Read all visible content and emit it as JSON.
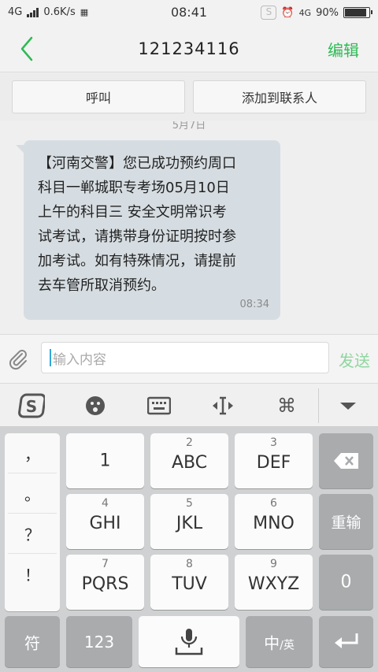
{
  "status_bar": {
    "network_left": "4G",
    "speed": "0.6K/s",
    "time": "08:41",
    "network_right": "4G",
    "battery": "90%",
    "battery_level": 0.9
  },
  "header": {
    "title": "121234116",
    "edit_label": "编辑",
    "accent_color": "#2fba55"
  },
  "actions": {
    "call_label": "呼叫",
    "add_contact_label": "添加到联系人"
  },
  "conversation": {
    "date": "5月7日",
    "messages": [
      {
        "lines": [
          "【河南交警】您已成功预约周口",
          "科目一郸城职专考场05月10日",
          "上午的科目三 安全文明常识考",
          "试考试，请携带身份证明按时参",
          "加考试。如有特殊情况，请提前",
          "去车管所取消预约。"
        ],
        "time": "08:34"
      }
    ]
  },
  "composer": {
    "placeholder": "输入内容",
    "send_label": "发送"
  },
  "ime_toolbar": {
    "icons": [
      "sogou-logo-icon",
      "emoji-icon",
      "keyboard-icon",
      "cursor-move-icon",
      "command-icon",
      "collapse-icon"
    ]
  },
  "keyboard": {
    "punctuation": [
      "，",
      "。",
      "？",
      "！"
    ],
    "keys": [
      {
        "num": "",
        "label": "1"
      },
      {
        "num": "2",
        "label": "ABC"
      },
      {
        "num": "3",
        "label": "DEF"
      },
      {
        "num": "4",
        "label": "GHI"
      },
      {
        "num": "5",
        "label": "JKL"
      },
      {
        "num": "6",
        "label": "MNO"
      },
      {
        "num": "7",
        "label": "PQRS"
      },
      {
        "num": "8",
        "label": "TUV"
      },
      {
        "num": "9",
        "label": "WXYZ"
      }
    ],
    "reinput_label": "重输",
    "zero_label": "0",
    "symbol_label": "符",
    "numbers_label": "123",
    "lang_main": "中",
    "lang_sep": "/",
    "lang_alt": "英"
  }
}
